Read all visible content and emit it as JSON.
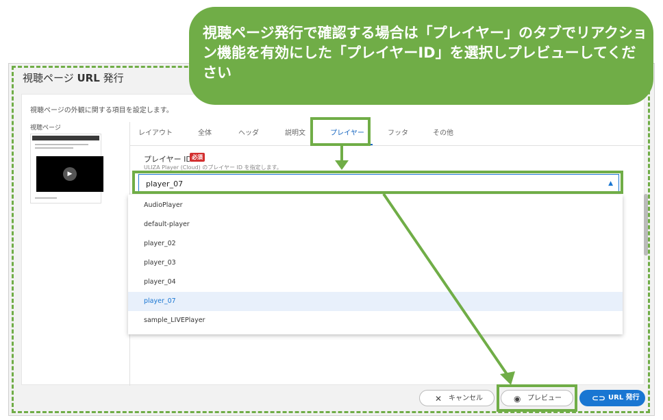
{
  "dialog": {
    "title_prefix": "視聴ページ",
    "title_bold": "URL",
    "title_suffix": "発行",
    "description": "視聴ページの外観に関する項目を設定します。",
    "side_label": "視聴ページ"
  },
  "tabs": [
    {
      "label": "レイアウト",
      "active": false
    },
    {
      "label": "全体",
      "active": false
    },
    {
      "label": "ヘッダ",
      "active": false
    },
    {
      "label": "説明文",
      "active": false
    },
    {
      "label": "プレイヤー",
      "active": true
    },
    {
      "label": "フッタ",
      "active": false
    },
    {
      "label": "その他",
      "active": false
    }
  ],
  "field": {
    "label": "プレイヤー ID",
    "required_badge": "必須",
    "hint": "ULIZA Player (Cloud) のプレイヤー ID を指定します。",
    "value": "player_07",
    "caret_icon": "caret-up-icon"
  },
  "dropdown": {
    "options": [
      "AudioPlayer",
      "default-player",
      "player_02",
      "player_03",
      "player_04",
      "player_07",
      "sample_LIVEPlayer"
    ],
    "selected": "player_07"
  },
  "footer": {
    "cancel_label": "キャンセル",
    "preview_label": "プレビュー",
    "issue_label": "URL 発行",
    "cancel_icon": "close-icon",
    "preview_icon": "eye-icon",
    "issue_icon": "link-icon"
  },
  "callout": {
    "text": "視聴ページ発行で確認する場合は「プレイヤー」のタブでリアクション機能を有効にした「プレイヤーID」を選択しプレビューしてください"
  },
  "colors": {
    "annotation_green": "#70ad47",
    "accent_blue": "#1976d2",
    "required_red": "#d32f2f"
  }
}
